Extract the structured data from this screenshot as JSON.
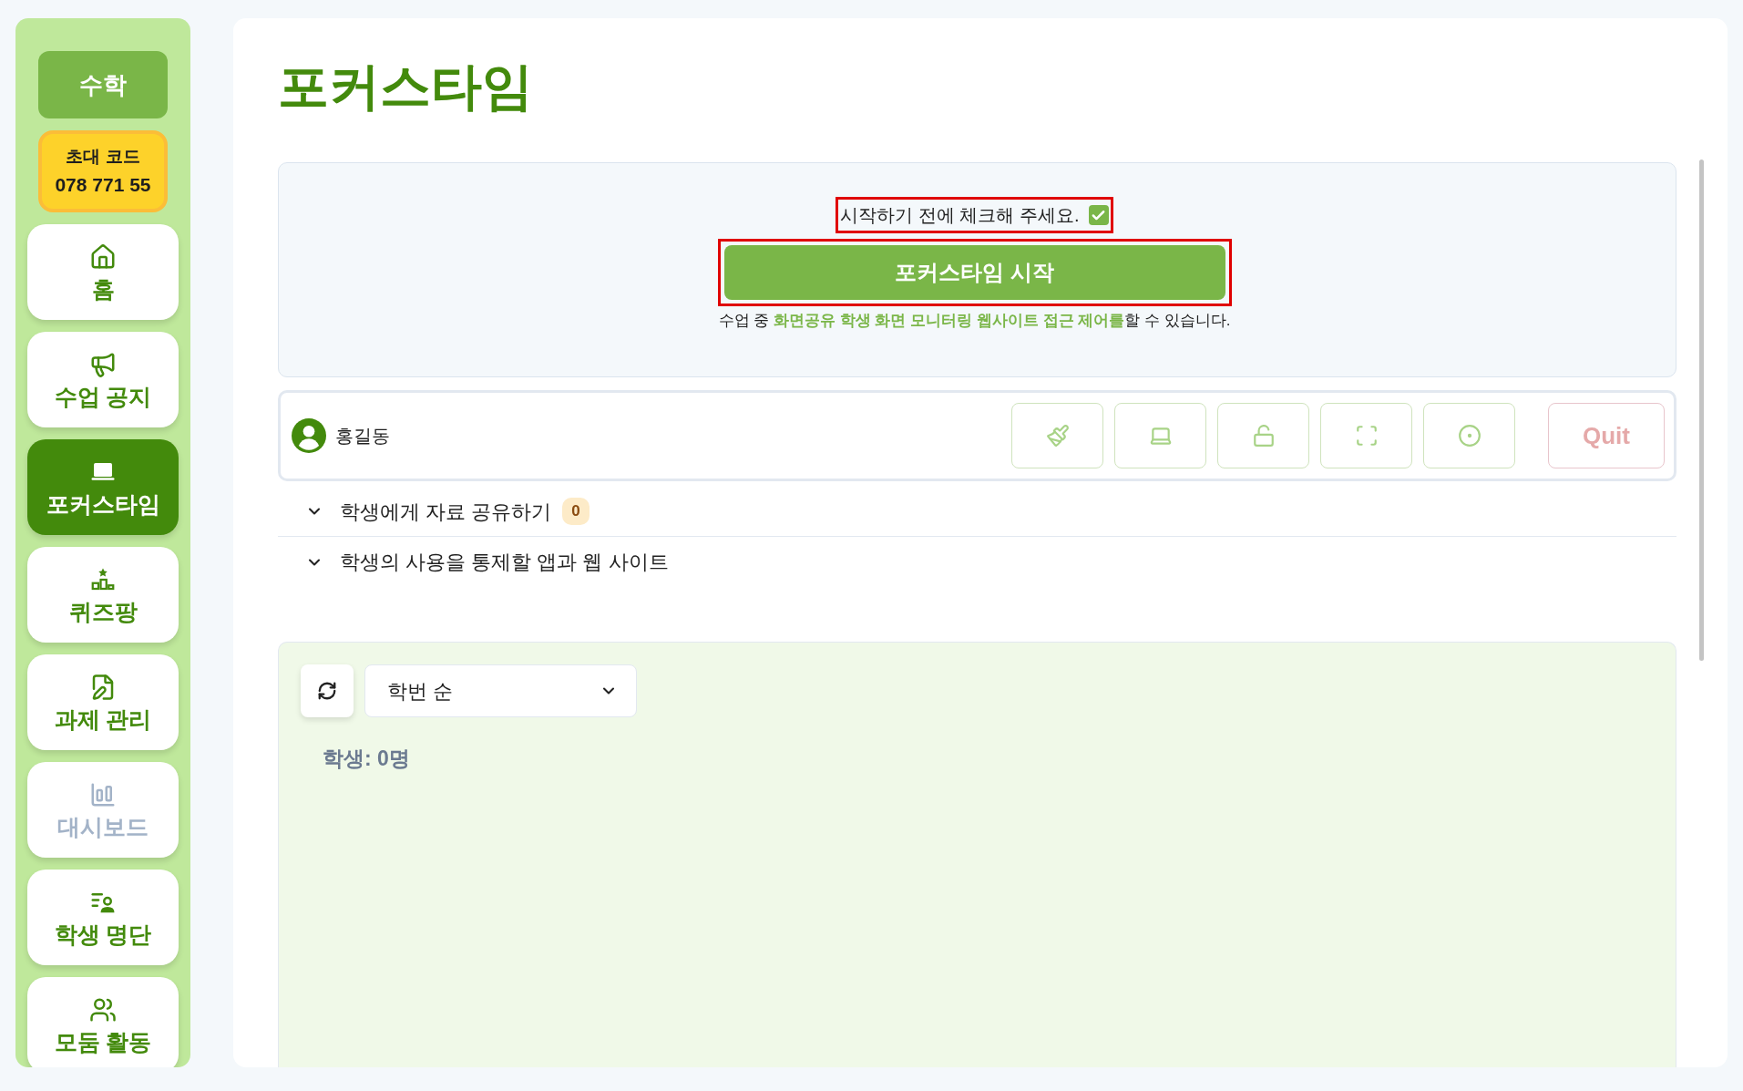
{
  "sidebar": {
    "subject": "수학",
    "invite": {
      "label": "초대 코드",
      "code": "078 771 55"
    },
    "items": [
      {
        "label": "홈",
        "selected": false,
        "disabled": false
      },
      {
        "label": "수업 공지",
        "selected": false,
        "disabled": false
      },
      {
        "label": "포커스타임",
        "selected": true,
        "disabled": false
      },
      {
        "label": "퀴즈팡",
        "selected": false,
        "disabled": false
      },
      {
        "label": "과제 관리",
        "selected": false,
        "disabled": false
      },
      {
        "label": "대시보드",
        "selected": false,
        "disabled": true
      },
      {
        "label": "학생 명단",
        "selected": false,
        "disabled": false
      },
      {
        "label": "모둠 활동",
        "selected": false,
        "disabled": false
      }
    ]
  },
  "page_title": "포커스타임",
  "start_panel": {
    "confirm": {
      "label": "시작하기 전에 체크해 주세요.",
      "checked": true,
      "highlighted": true
    },
    "start_button": {
      "label": "포커스타임 시작",
      "highlighted": true
    },
    "description": "수업 중 **화면공유 학생 화면 모니터링 웹사이트 접근 제어를**할 수 있습니다."
  },
  "session_bar": {
    "teacher": "홍길동",
    "tools": [
      {
        "kind": "brush",
        "disabled": true
      },
      {
        "kind": "screen-share",
        "disabled": true
      },
      {
        "kind": "lock",
        "disabled": true
      },
      {
        "kind": "fullscreen",
        "disabled": true
      },
      {
        "kind": "record",
        "disabled": true
      }
    ],
    "quit": {
      "label": "Quit",
      "disabled": true
    }
  },
  "sections": [
    {
      "label": "학생에게 자료 공유하기",
      "count": "0",
      "expanded": false
    },
    {
      "label": "학생의 사용을 통제할 앱과 웹 사이트",
      "expanded": false
    }
  ],
  "students": {
    "sort": "학번 순",
    "count_label": "학생: 0명"
  }
}
